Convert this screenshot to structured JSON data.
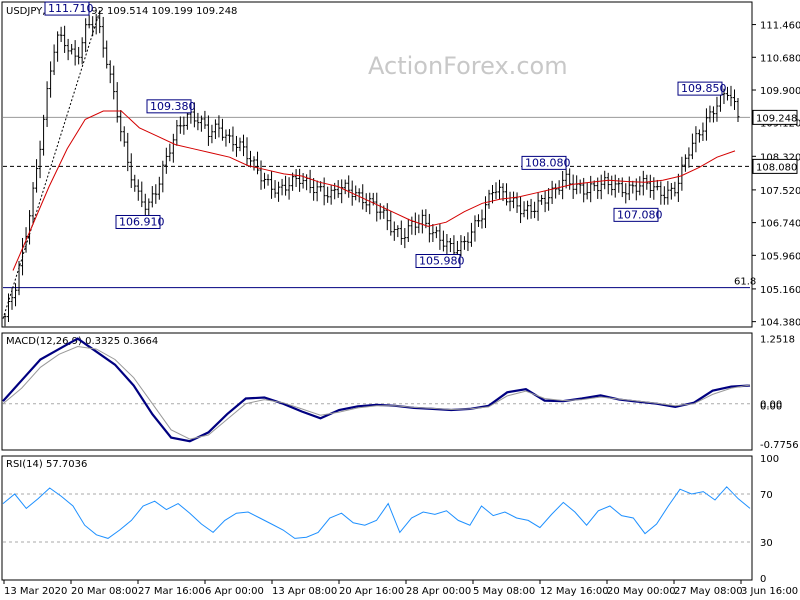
{
  "header": {
    "symbol_info": "USDJPY,H4  109.492 109.514 109.199 109.248",
    "watermark": "ActionForex.com"
  },
  "chart_data": [
    {
      "type": "candlestick",
      "title": "USDJPY,H4  109.492 109.514 109.199 109.248",
      "ylim": [
        104.3,
        111.95
      ],
      "y_ticks": [
        "111.460",
        "110.680",
        "109.900",
        "109.120",
        "108.320",
        "107.520",
        "106.740",
        "105.960",
        "105.160",
        "104.380"
      ],
      "x_labels": [
        "13 Mar 2020",
        "20 Mar 08:00",
        "27 Mar 16:00",
        "6 Apr 00:00",
        "13 Apr 08:00",
        "20 Apr 16:00",
        "28 Apr 00:00",
        "5 May 08:00",
        "12 May 16:00",
        "20 May 00:00",
        "27 May 08:00",
        "3 Jun 16:00"
      ],
      "current_price": "109.248",
      "resistance_level": "108.080",
      "fib_level": {
        "label": "61.8",
        "value": 105.19
      },
      "annotations": [
        {
          "label": "111.710",
          "value": 111.71
        },
        {
          "label": "109.380",
          "value": 109.38
        },
        {
          "label": "106.910",
          "value": 106.91
        },
        {
          "label": "105.980",
          "value": 105.98
        },
        {
          "label": "108.080",
          "value": 108.08
        },
        {
          "label": "107.080",
          "value": 107.08
        },
        {
          "label": "109.850",
          "value": 109.85
        }
      ],
      "price_path": [
        104.5,
        105.2,
        106.4,
        107.8,
        109.6,
        111.2,
        111.0,
        110.6,
        111.4,
        111.6,
        110.6,
        109.4,
        108.2,
        107.4,
        107.1,
        107.6,
        108.4,
        109.0,
        109.3,
        109.2,
        108.9,
        109.0,
        108.7,
        108.6,
        108.3,
        107.9,
        107.6,
        107.5,
        107.7,
        107.8,
        107.6,
        107.5,
        107.4,
        107.6,
        107.5,
        107.3,
        107.2,
        107.0,
        106.6,
        106.4,
        106.7,
        106.8,
        106.5,
        106.3,
        106.1,
        106.2,
        106.6,
        107.0,
        107.6,
        107.4,
        107.2,
        107.0,
        107.1,
        107.3,
        107.5,
        107.8,
        107.6,
        107.5,
        107.6,
        107.7,
        107.6,
        107.5,
        107.6,
        107.7,
        107.5,
        107.4,
        107.6,
        108.4,
        108.8,
        109.2,
        109.6,
        109.9,
        109.3
      ],
      "ma_path": [
        105.6,
        106.6,
        107.6,
        108.5,
        109.2,
        109.4,
        109.4,
        109.0,
        108.8,
        108.6,
        108.5,
        108.4,
        108.3,
        108.1,
        108.0,
        107.9,
        107.85,
        107.7,
        107.6,
        107.4,
        107.2,
        107.0,
        106.8,
        106.65,
        106.75,
        107.0,
        107.2,
        107.3,
        107.35,
        107.45,
        107.55,
        107.65,
        107.7,
        107.75,
        107.72,
        107.7,
        107.75,
        107.85,
        108.05,
        108.3,
        108.45
      ]
    },
    {
      "type": "line",
      "title": "MACD(12,26,9) 0.3325 0.3664",
      "series": [
        {
          "name": "MACD",
          "values": [
            0.05,
            0.45,
            0.85,
            1.05,
            1.25,
            1.0,
            0.75,
            0.35,
            -0.2,
            -0.65,
            -0.72,
            -0.55,
            -0.2,
            0.1,
            0.12,
            0.0,
            -0.15,
            -0.28,
            -0.12,
            -0.05,
            -0.02,
            -0.04,
            -0.08,
            -0.1,
            -0.12,
            -0.1,
            -0.04,
            0.22,
            0.28,
            0.06,
            0.05,
            0.1,
            0.16,
            0.08,
            0.04,
            0.0,
            -0.06,
            0.02,
            0.25,
            0.33,
            0.35
          ]
        },
        {
          "name": "Signal",
          "values": [
            0.0,
            0.3,
            0.7,
            0.95,
            1.1,
            1.05,
            0.85,
            0.5,
            0.0,
            -0.5,
            -0.68,
            -0.6,
            -0.3,
            0.0,
            0.08,
            0.02,
            -0.1,
            -0.22,
            -0.16,
            -0.08,
            -0.04,
            -0.04,
            -0.07,
            -0.09,
            -0.11,
            -0.1,
            -0.06,
            0.15,
            0.24,
            0.1,
            0.06,
            0.08,
            0.13,
            0.09,
            0.05,
            0.01,
            -0.04,
            0.0,
            0.18,
            0.3,
            0.36
          ]
        }
      ],
      "y_ticks": [
        "1.2518",
        "0.00",
        "0.00",
        "-0.7756"
      ],
      "ylim": [
        -0.85,
        1.32
      ]
    },
    {
      "type": "line",
      "title": "RSI(14) 57.7036",
      "series": [
        {
          "name": "RSI",
          "values": [
            62,
            70,
            58,
            66,
            75,
            68,
            60,
            44,
            36,
            33,
            40,
            48,
            60,
            64,
            57,
            62,
            54,
            45,
            38,
            48,
            54,
            55,
            50,
            45,
            40,
            33,
            34,
            38,
            50,
            54,
            46,
            44,
            48,
            62,
            38,
            50,
            55,
            53,
            56,
            48,
            44,
            60,
            52,
            55,
            50,
            48,
            42,
            53,
            63,
            55,
            44,
            56,
            60,
            52,
            50,
            37,
            45,
            60,
            74,
            70,
            72,
            65,
            76,
            66,
            58
          ]
        }
      ],
      "levels": [
        70,
        30
      ],
      "y_ticks": [
        "100",
        "70",
        "30",
        "0"
      ],
      "ylim": [
        0,
        100
      ]
    }
  ]
}
